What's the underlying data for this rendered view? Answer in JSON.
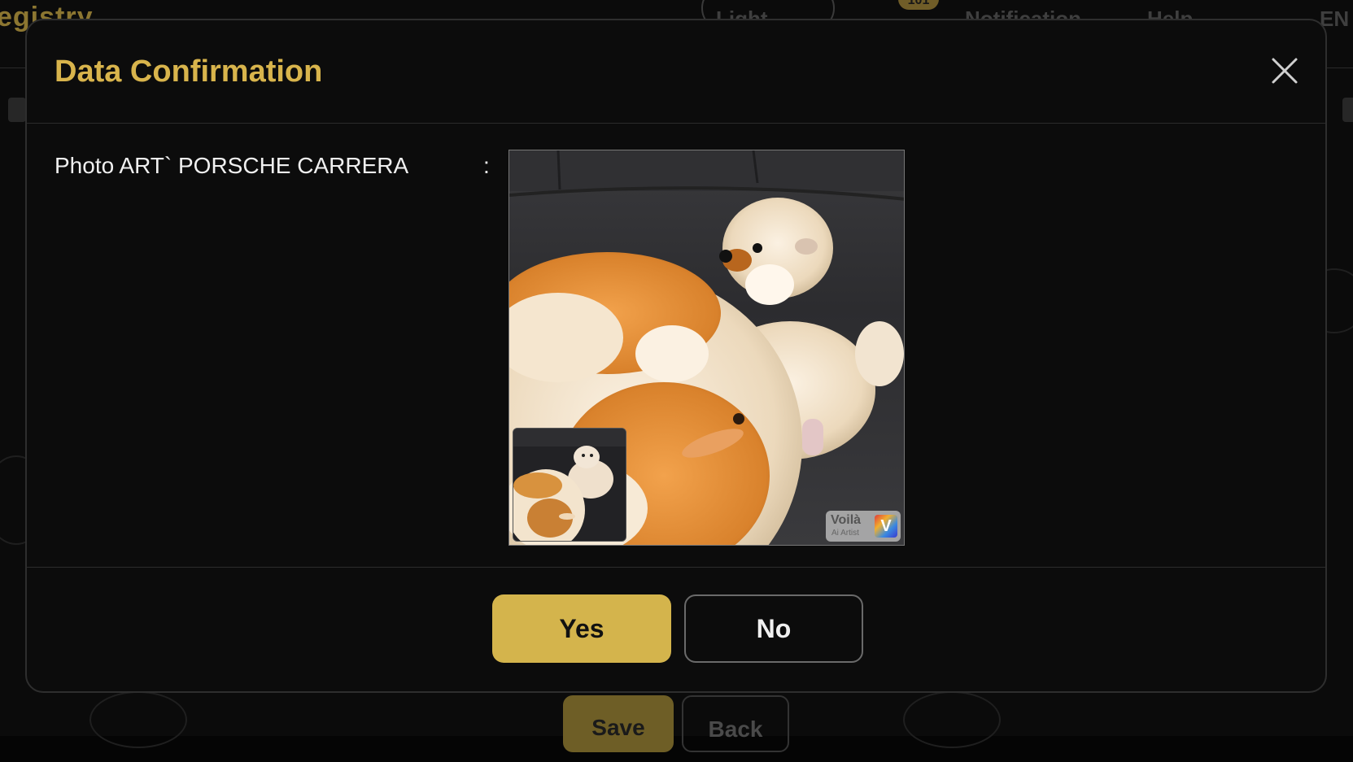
{
  "background": {
    "logo_text": "egistry",
    "nav": {
      "theme_label": "Light",
      "notification_badge": "101",
      "notification_label": "Notification",
      "help_label": "Help",
      "language_label": "EN"
    },
    "save_label": "Save",
    "back_label": "Back"
  },
  "modal": {
    "title": "Data Confirmation",
    "field_label": "Photo ART` PORSCHE CARRERA",
    "field_separator": ":",
    "watermark": {
      "brand": "Voilà",
      "sub": "Ai Artist",
      "mark": "V"
    },
    "yes_label": "Yes",
    "no_label": "No"
  },
  "colors": {
    "accent": "#d4b44c",
    "title": "#d8b44c",
    "modal_bg": "#0c0c0c"
  },
  "icons": {
    "close": "close-icon",
    "theme": "sun-icon",
    "mail": "mail-icon",
    "help": "help-icon",
    "language": "language-icon"
  }
}
